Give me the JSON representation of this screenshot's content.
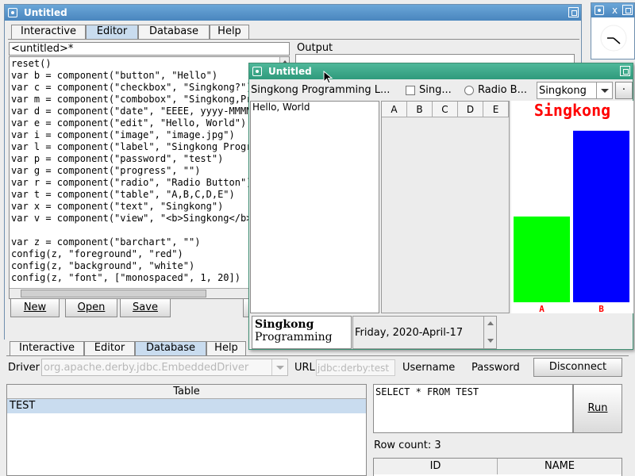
{
  "main_window": {
    "title": "Untitled",
    "tabs": [
      "Interactive",
      "Editor",
      "Database",
      "Help"
    ],
    "selected_tab": "Editor",
    "file_name": "<untitled>*",
    "output_label": "Output",
    "code": [
      "reset()",
      "var b = component(\"button\", \"Hello\")",
      "var c = component(\"checkbox\", \"Singkong?\")",
      "var m = component(\"combobox\", \"Singkong,Pro",
      "var d = component(\"date\", \"EEEE, yyyy-MMMM-",
      "var e = component(\"edit\", \"Hello, World\")",
      "var i = component(\"image\", \"image.jpg\")",
      "var l = component(\"label\", \"Singkong Progra",
      "var p = component(\"password\", \"test\")",
      "var g = component(\"progress\", \"\")",
      "var r = component(\"radio\", \"Radio Button\")",
      "var t = component(\"table\", \"A,B,C,D,E\")",
      "var x = component(\"text\", \"Singkong\")",
      "var v = component(\"view\", \"<b>Singkong</b><",
      "",
      "var z = component(\"barchart\", \"\")",
      "config(z, \"foreground\", \"red\")",
      "config(z, \"background\", \"white\")",
      "config(z, \"font\", [\"monospaced\", 1, 20])"
    ],
    "buttons": {
      "new": "New",
      "open": "Open",
      "save": "Save"
    }
  },
  "lower_panel": {
    "tabs": [
      "Interactive",
      "Editor",
      "Database",
      "Help"
    ],
    "selected_tab": "Database",
    "driver_label": "Driver",
    "driver_value": "org.apache.derby.jdbc.EmbeddedDriver",
    "url_label": "URL",
    "url_value": "jdbc:derby:test",
    "username_label": "Username",
    "password_label": "Password",
    "disconnect_label": "Disconnect",
    "table_header": "Table",
    "tables": [
      "TEST"
    ],
    "query": "SELECT * FROM TEST",
    "run_label": "Run",
    "row_count": "Row count: 3",
    "result_columns": [
      "ID",
      "NAME"
    ]
  },
  "popup_window": {
    "title": "Untitled",
    "label_text": "Singkong Programming L...",
    "checkbox_label": "Sing...",
    "radio_label": "Radio B...",
    "combo_value": "Singkong",
    "edit_text": "Hello, World",
    "table_columns": [
      "A",
      "B",
      "C",
      "D",
      "E"
    ],
    "view_bold": "Singkong",
    "view_normal": "Programming",
    "date_value": "Friday, 2020-April-17"
  },
  "chart_data": {
    "type": "bar",
    "title": "Singkong",
    "categories": [
      "A",
      "B"
    ],
    "values": [
      47,
      94
    ],
    "ylim": [
      0,
      100
    ],
    "colors": [
      "#00ff00",
      "#0000ff"
    ],
    "foreground": "#ff0000",
    "background": "#ffffff"
  },
  "clock_window": {
    "close_label": "x"
  }
}
